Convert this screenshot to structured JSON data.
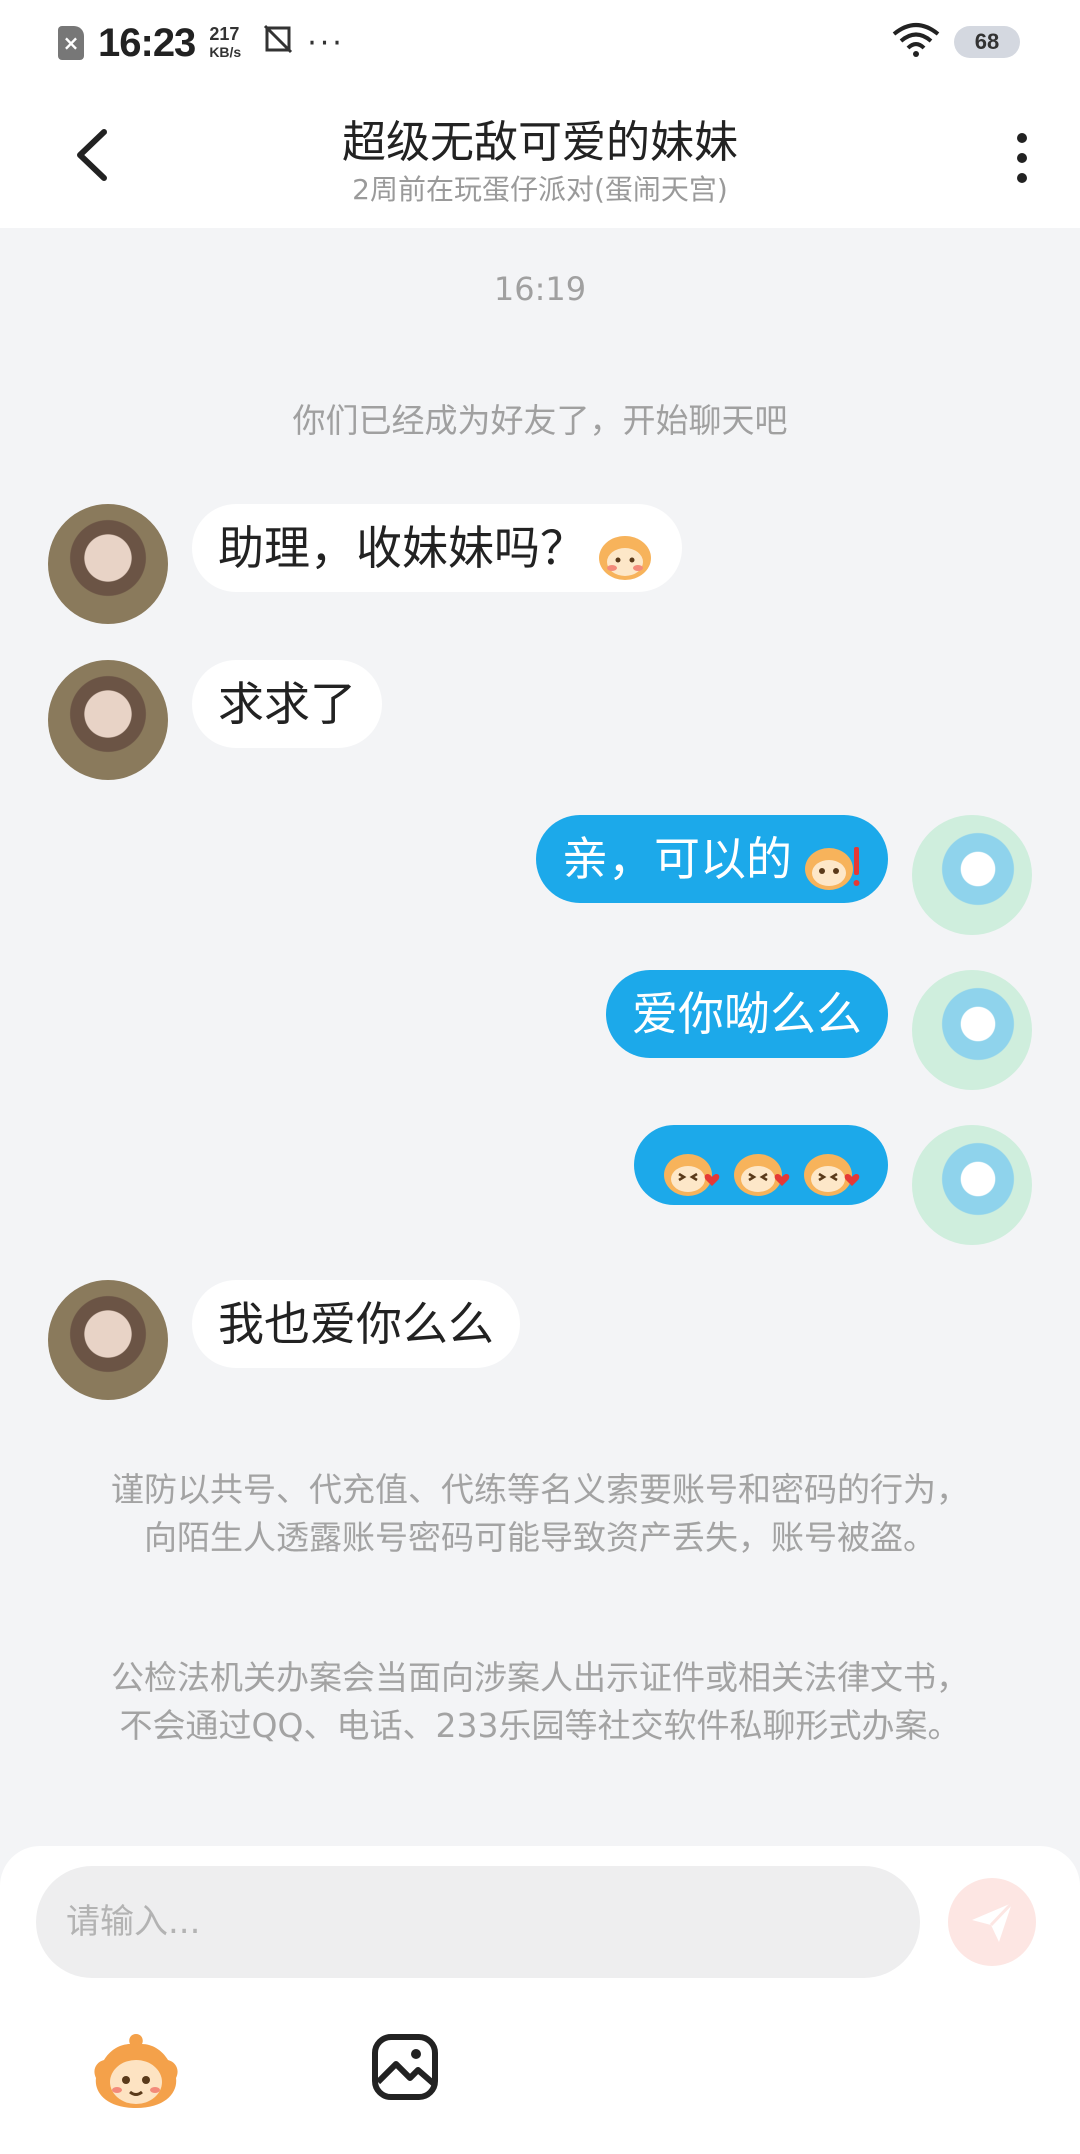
{
  "status_bar": {
    "time": "16:23",
    "speed_value": "217",
    "speed_unit": "KB/s",
    "battery": "68",
    "more": "···"
  },
  "header": {
    "title": "超级无敌可爱的妹妹",
    "subtitle": "2周前在玩蛋仔派对(蛋闹天宫)"
  },
  "chat": {
    "time_label": "16:19",
    "system_tip": "你们已经成为好友了，开始聊天吧",
    "messages": [
      {
        "side": "left",
        "text": "助理，收妹妹吗？",
        "emoji": "shy-egg-emoji"
      },
      {
        "side": "left",
        "text": "求求了"
      },
      {
        "side": "right",
        "text": "亲，可以的",
        "emoji": "excited-egg-emoji"
      },
      {
        "side": "right",
        "text": "爱你呦么么"
      },
      {
        "side": "right",
        "text": "",
        "emoji": "kiss-egg-emoji x3"
      },
      {
        "side": "left",
        "text": "我也爱你么么"
      }
    ]
  },
  "notices": {
    "security": "谨防以共号、代充值、代练等名义索要账号和密码的行为，向陌生人透露账号密码可能导致资产丢失，账号被盗。",
    "police": "公检法机关办案会当面向涉案人出示证件或相关法律文书，不会通过QQ、电话、233乐园等社交软件私聊形式办案。"
  },
  "input": {
    "placeholder": "请输入..."
  },
  "colors": {
    "bubble_out": "#1ca9ea",
    "bubble_in": "#ffffff",
    "background": "#f3f4f6",
    "send_button": "#fde6e3"
  }
}
